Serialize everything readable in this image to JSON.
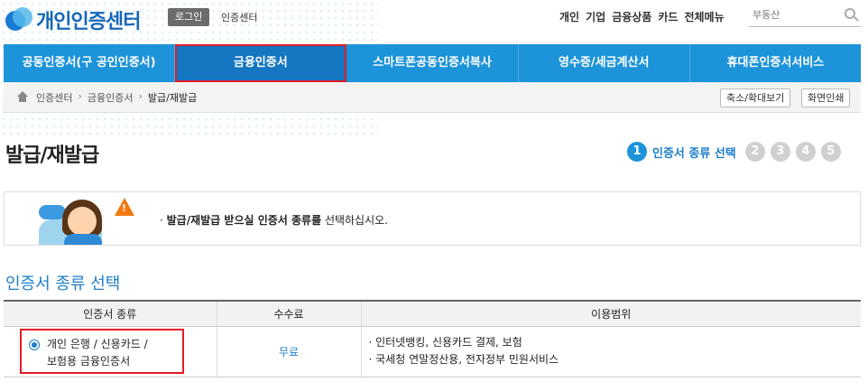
{
  "header": {
    "logo_text": "개인인증센터",
    "login_label": "로그인",
    "cert_center_link": "인증센터",
    "topnav": [
      "개인",
      "기업",
      "금융상품",
      "카드",
      "전체메뉴"
    ],
    "search_placeholder": "부동산"
  },
  "mainnav": [
    {
      "label": "공동인증서(구 공인인증서)",
      "active": false
    },
    {
      "label": "금융인증서",
      "active": true
    },
    {
      "label": "스마트폰공동인증서복사",
      "active": false
    },
    {
      "label": "영수증/세금계산서",
      "active": false
    },
    {
      "label": "휴대폰인증서서비스",
      "active": false
    }
  ],
  "breadcrumb": [
    "인증센터",
    "금융인증서",
    "발급/재발급"
  ],
  "tools": {
    "zoom": "축소/확대보기",
    "print": "화면인쇄"
  },
  "page_title": "발급/재발급",
  "steps": {
    "current_label": "인증서 종류 선택",
    "numbers": [
      "1",
      "2",
      "3",
      "4",
      "5"
    ]
  },
  "notice": {
    "bold": "발급/재발급 받으실 인증서 종류를",
    "rest": " 선택하십시오."
  },
  "section_title": "인증서 종류 선택",
  "table": {
    "headers": [
      "인증서 종류",
      "수수료",
      "이용범위"
    ],
    "rows": [
      {
        "type_line1": "개인 은행 / 신용카드 /",
        "type_line2": "보험용 금융인증서",
        "fee": "무료",
        "usage": [
          "인터넷뱅킹, 신용카드 결제, 보험",
          "국세청 연말정산용, 전자정부 민원서비스"
        ],
        "selected": true
      }
    ]
  }
}
